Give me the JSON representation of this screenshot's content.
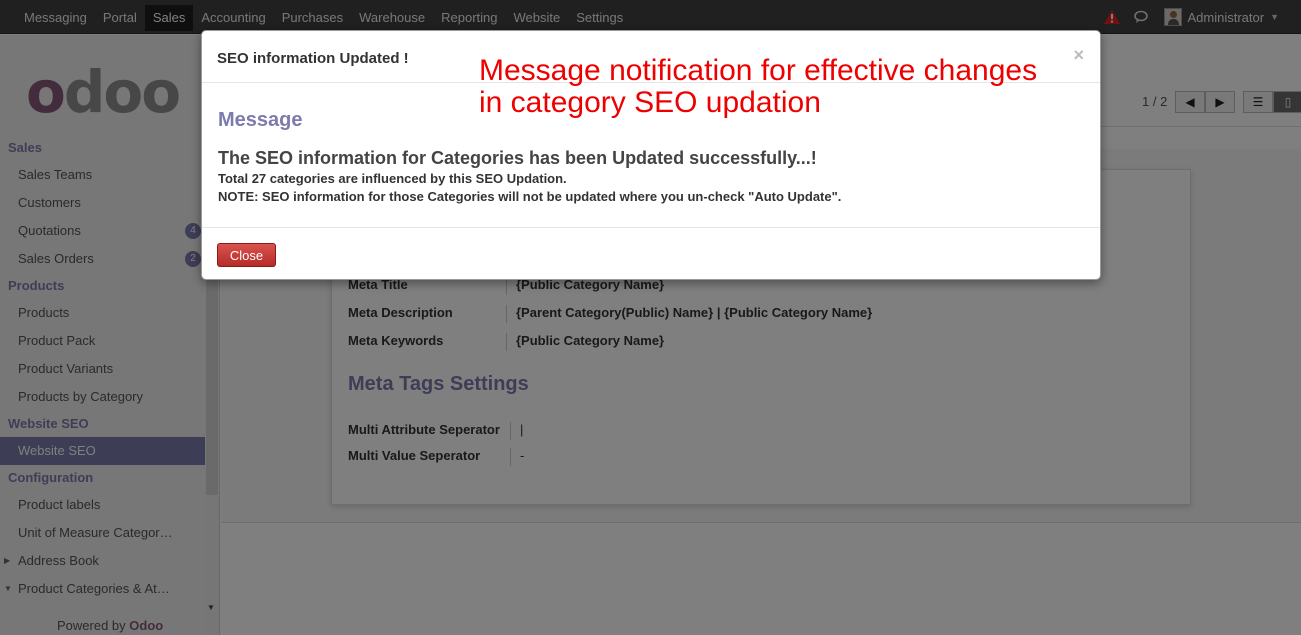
{
  "topbar": {
    "menu": [
      "Messaging",
      "Portal",
      "Sales",
      "Accounting",
      "Purchases",
      "Warehouse",
      "Reporting",
      "Website",
      "Settings"
    ],
    "active": "Sales",
    "user": "Administrator"
  },
  "logo": {
    "first": "o",
    "rest": "doo"
  },
  "sidebar": {
    "sales_header": "Sales",
    "sales_teams": "Sales Teams",
    "customers": "Customers",
    "quotations": "Quotations",
    "quotations_count": "4",
    "sales_orders": "Sales Orders",
    "sales_orders_count": "2",
    "products_header": "Products",
    "products": "Products",
    "product_pack": "Product Pack",
    "product_variants": "Product Variants",
    "products_by_category": "Products by Category",
    "website_seo_header": "Website SEO",
    "website_seo": "Website SEO",
    "configuration_header": "Configuration",
    "product_labels": "Product labels",
    "uom_categories": "Unit of Measure Categor…",
    "address_book": "Address Book",
    "product_categories": "Product Categories & At…",
    "powered_by": "Powered by",
    "powered_brand": "Odoo"
  },
  "pager": {
    "text": "1 / 2"
  },
  "form": {
    "meta_title_label": "Meta Title",
    "meta_title_value": "{Public Category Name}",
    "meta_description_label": "Meta Description",
    "meta_description_value": "{Parent Category(Public) Name} | {Public Category Name}",
    "meta_keywords_label": "Meta Keywords",
    "meta_keywords_value": "{Public Category Name}",
    "section_title": "Meta Tags Settings",
    "multi_attr_label": "Multi Attribute Seperator",
    "multi_attr_value": "|",
    "multi_value_label": "Multi Value Seperator",
    "multi_value_value": "-"
  },
  "modal": {
    "title": "SEO information Updated !",
    "close_x": "×",
    "annotation_line1": "Message notification for effective changes",
    "annotation_line2": "in category SEO updation",
    "heading": "Message",
    "main_text": "The SEO information for Categories has been Updated successfully...!",
    "detail1": "Total 27 categories are influenced by this SEO Updation.",
    "detail2": "NOTE: SEO information for those Categories will not be updated where you un-check \"Auto Update\".",
    "close_label": "Close"
  },
  "colors": {
    "accent": "#7c7bad",
    "brand": "#875a7b",
    "danger": "#c9302c",
    "annotation": "#ee0000"
  }
}
